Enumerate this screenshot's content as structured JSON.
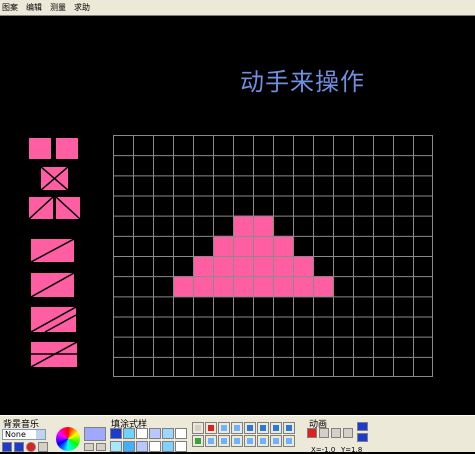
{
  "menu": {
    "items": [
      {
        "label": "图案",
        "name": "menu-pattern"
      },
      {
        "label": "编辑",
        "name": "menu-edit"
      },
      {
        "label": "测量",
        "name": "menu-measure"
      },
      {
        "label": "求助",
        "name": "menu-help"
      }
    ]
  },
  "canvas": {
    "title": "动手来操作",
    "grid_rows": 12,
    "grid_cols": 16,
    "shape_color": "#ff5ea3",
    "title_color": "#6f8fe0",
    "shape_cells": [
      [
        4,
        6
      ],
      [
        4,
        7
      ],
      [
        5,
        5
      ],
      [
        5,
        6
      ],
      [
        5,
        7
      ],
      [
        5,
        8
      ],
      [
        6,
        4
      ],
      [
        6,
        5
      ],
      [
        6,
        6
      ],
      [
        6,
        7
      ],
      [
        6,
        8
      ],
      [
        6,
        9
      ],
      [
        7,
        3
      ],
      [
        7,
        4
      ],
      [
        7,
        5
      ],
      [
        7,
        6
      ],
      [
        7,
        7
      ],
      [
        7,
        8
      ],
      [
        7,
        9
      ],
      [
        7,
        10
      ]
    ]
  },
  "palette": {
    "tiles": [
      {
        "name": "split-square-tile"
      },
      {
        "name": "x-square-tile"
      },
      {
        "name": "diagonal-pair-tile"
      },
      {
        "name": "parallelogram-tile-1"
      },
      {
        "name": "parallelogram-tile-2"
      },
      {
        "name": "parallelogram-tile-3"
      },
      {
        "name": "parallelogram-tile-4"
      }
    ]
  },
  "toolbar": {
    "music_label": "背景音乐",
    "music_value": "None",
    "fill_label": "填涂式样",
    "animation_label": "动画",
    "coord_x": "X=-1.0",
    "coord_y": "Y=1.8",
    "tool_icons": [
      "rectangle-tool-icon",
      "delete-icon",
      "square-icon",
      "rectangle-icon",
      "ellipse-icon",
      "circle-icon",
      "pentagon-icon",
      "triangle-icon",
      "grid-icon",
      "edit-icon",
      "move-icon",
      "zoom-icon",
      "rotate-icon",
      "flip-icon",
      "color-icon",
      "erase-icon"
    ]
  }
}
